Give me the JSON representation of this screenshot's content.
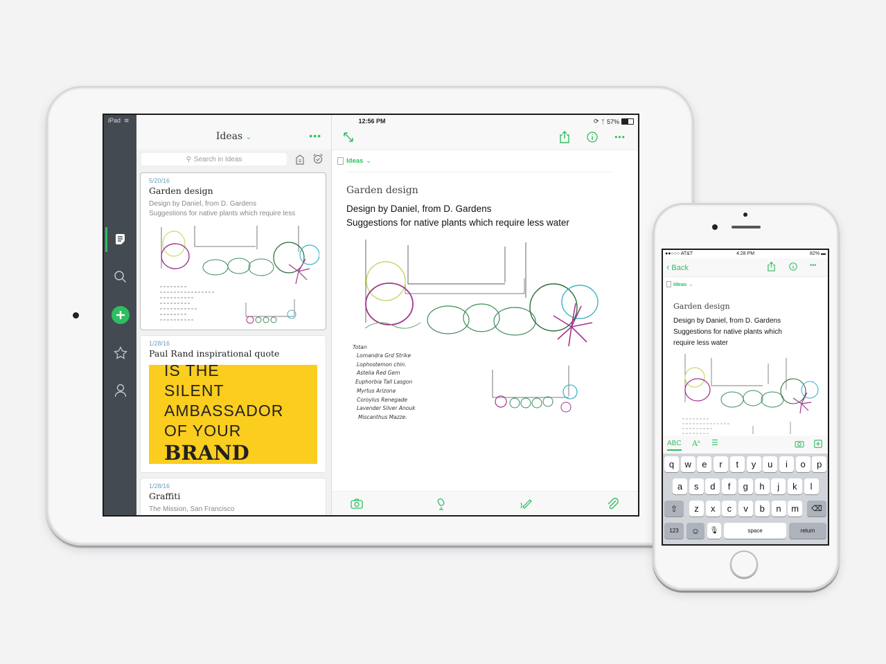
{
  "ipad": {
    "status": {
      "device": "iPad",
      "time": "12:56 PM",
      "battery": "57%"
    },
    "sidebar": {
      "items": [
        {
          "name": "notes",
          "active": true
        },
        {
          "name": "search",
          "active": false
        },
        {
          "name": "new-note",
          "active": false
        },
        {
          "name": "shortcuts",
          "active": false
        },
        {
          "name": "account",
          "active": false
        }
      ],
      "accent": "#2dbe60"
    },
    "list": {
      "title": "Ideas",
      "search_placeholder": "Search in Ideas",
      "notes": [
        {
          "date": "5/20/16",
          "title": "Garden design",
          "snippet": [
            "Design by Daniel, from D. Gardens",
            "Suggestions for native plants which require less"
          ],
          "selected": true
        },
        {
          "date": "1/28/16",
          "title": "Paul Rand inspirational quote",
          "quote": [
            "IS THE",
            "SILENT",
            "AMBASSADOR",
            "OF YOUR",
            "BRAND"
          ]
        },
        {
          "date": "1/28/16",
          "title": "Graffiti",
          "snippet": [
            "The Mission, San Francisco"
          ]
        }
      ]
    },
    "editor": {
      "notebook": "Ideas",
      "title": "Garden design",
      "body": [
        "Design by Daniel, from D. Gardens",
        "Suggestions for native plants which require less water"
      ],
      "sketch_labels": [
        "Totan",
        "Lomandra Grd Strike",
        "Lophostemon chin.",
        "Astelia Red Gem",
        "Euphorbia Tall Lasgon",
        "Myrtus Arizona",
        "Coroylus Renegade",
        "Lavender Silver Anouk",
        "Miscanthus Mazze."
      ],
      "toolbar": [
        "camera",
        "audio",
        "sketch",
        "attachment"
      ]
    }
  },
  "iphone": {
    "status": {
      "carrier": "AT&T",
      "time": "4:28 PM",
      "battery": "82%"
    },
    "nav": {
      "back": "Back"
    },
    "notebook": "Ideas",
    "title": "Garden design",
    "body": [
      "Design by Daniel, from D. Gardens",
      "Suggestions for native plants which",
      "require less water"
    ],
    "format_bar": {
      "abc": "ABC"
    },
    "keyboard": {
      "row1": [
        "q",
        "w",
        "e",
        "r",
        "t",
        "y",
        "u",
        "i",
        "o",
        "p"
      ],
      "row2": [
        "a",
        "s",
        "d",
        "f",
        "g",
        "h",
        "j",
        "k",
        "l"
      ],
      "row3": [
        "z",
        "x",
        "c",
        "v",
        "b",
        "n",
        "m"
      ],
      "numbers": "123",
      "space": "space",
      "return": "return"
    }
  }
}
